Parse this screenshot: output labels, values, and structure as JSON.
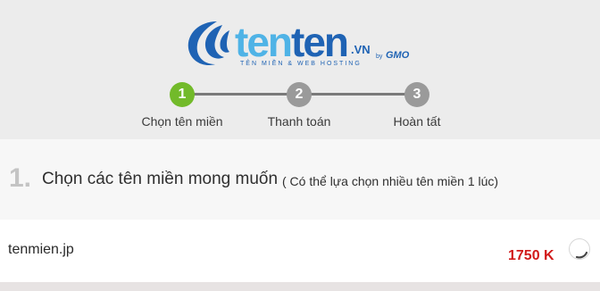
{
  "brand": {
    "word_part1": "ten",
    "word_part2": "ten",
    "tld": ".VN",
    "by": "by",
    "company": "GMO",
    "tagline": "TÊN MIỀN & WEB HOSTING",
    "colors": {
      "light_blue": "#4fb3e6",
      "dark_blue": "#1f63b4"
    }
  },
  "steps": [
    {
      "number": "1",
      "label": "Chọn tên miền",
      "state": "active",
      "color": "#72ba2a"
    },
    {
      "number": "2",
      "label": "Thanh toán",
      "state": "pending",
      "color": "#9a9a9a"
    },
    {
      "number": "3",
      "label": "Hoàn tất",
      "state": "pending",
      "color": "#9a9a9a"
    }
  ],
  "section": {
    "number": "1.",
    "title": "Chọn các tên miền mong muốn",
    "note": "( Có thể lựa chọn nhiều tên miền 1 lúc)"
  },
  "domains": [
    {
      "name": "tenmien.jp",
      "price": "1750 K",
      "selection_icon": "loading-spinner-icon"
    }
  ]
}
